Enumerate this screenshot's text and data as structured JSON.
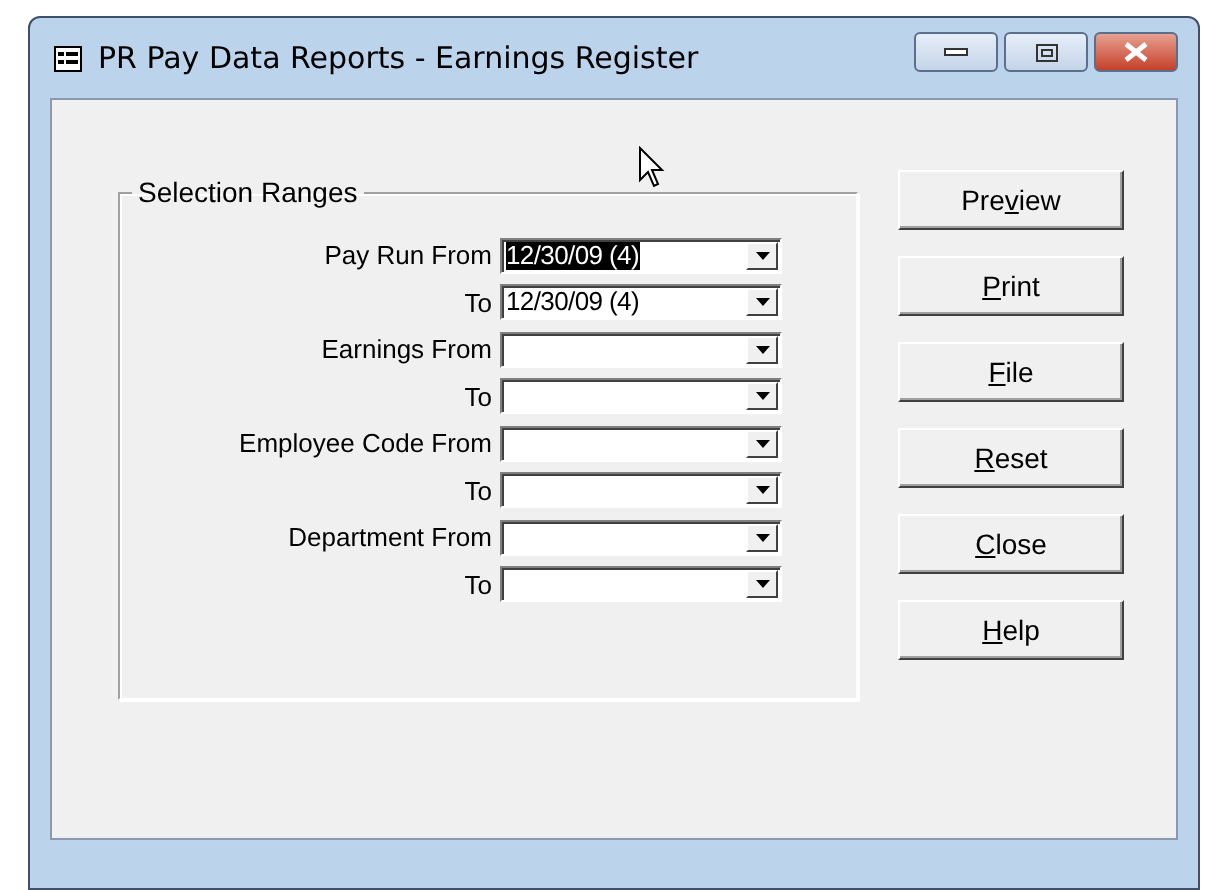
{
  "window": {
    "title": "PR Pay Data Reports - Earnings Register"
  },
  "selection_ranges": {
    "title": "Selection Ranges",
    "rows": [
      {
        "label": "Pay Run From",
        "value": "12/30/09 (4)",
        "highlighted": true
      },
      {
        "label": "To",
        "value": "12/30/09 (4)",
        "highlighted": false
      },
      {
        "label": "Earnings From"
      },
      {
        "label": "To"
      },
      {
        "label": "Employee Code From"
      },
      {
        "label": "To"
      },
      {
        "label": "Department From"
      },
      {
        "label": "To"
      }
    ]
  },
  "buttons": [
    {
      "before": "Pre",
      "key": "v",
      "after": "iew"
    },
    {
      "key": "P",
      "after": "rint"
    },
    {
      "key": "F",
      "after": "ile"
    },
    {
      "key": "R",
      "after": "eset"
    },
    {
      "key": "C",
      "after": "lose"
    },
    {
      "key": "H",
      "after": "elp"
    }
  ]
}
